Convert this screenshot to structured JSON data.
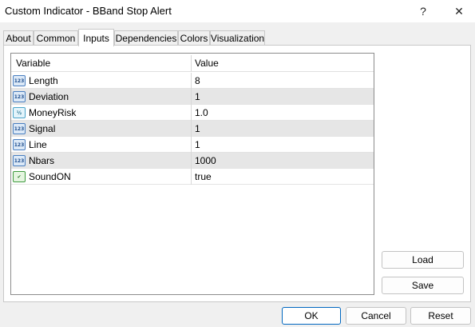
{
  "window": {
    "title": "Custom Indicator - BBand Stop Alert",
    "help_glyph": "?",
    "close_glyph": "✕"
  },
  "tabs": [
    {
      "label": "About"
    },
    {
      "label": "Common"
    },
    {
      "label": "Inputs",
      "active": true
    },
    {
      "label": "Dependencies"
    },
    {
      "label": "Colors"
    },
    {
      "label": "Visualization"
    }
  ],
  "grid": {
    "headers": {
      "variable": "Variable",
      "value": "Value"
    },
    "rows": [
      {
        "icon": "int-type-icon",
        "icon_glyph": "123",
        "variable": "Length",
        "value": "8"
      },
      {
        "icon": "int-type-icon",
        "icon_glyph": "123",
        "variable": "Deviation",
        "value": "1"
      },
      {
        "icon": "double-type-icon",
        "icon_glyph": "½",
        "variable": "MoneyRisk",
        "value": "1.0"
      },
      {
        "icon": "int-type-icon",
        "icon_glyph": "123",
        "variable": "Signal",
        "value": "1"
      },
      {
        "icon": "int-type-icon",
        "icon_glyph": "123",
        "variable": "Line",
        "value": "1"
      },
      {
        "icon": "int-type-icon",
        "icon_glyph": "123",
        "variable": "Nbars",
        "value": "1000"
      },
      {
        "icon": "bool-type-icon",
        "icon_glyph": "✔",
        "variable": "SoundON",
        "value": "true"
      }
    ]
  },
  "buttons": {
    "load": "Load",
    "save": "Save",
    "ok": "OK",
    "cancel": "Cancel",
    "reset": "Reset"
  },
  "colors": {
    "accent": "#0067c0",
    "alt_row": "#e6e6e6"
  }
}
